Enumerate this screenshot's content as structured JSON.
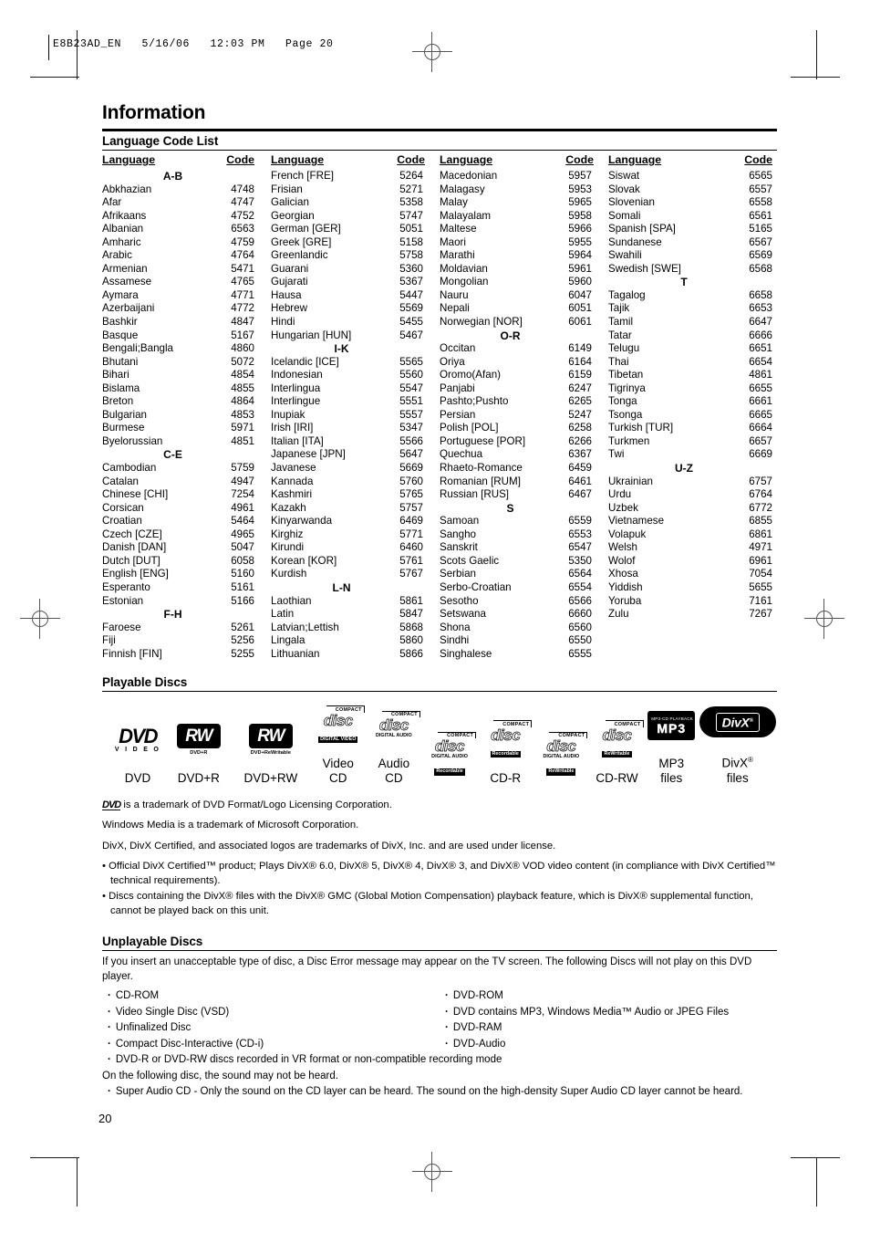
{
  "print_stamp": "E8B23AD_EN   5/16/06   12:03 PM   Page 20",
  "chapter_title": "Information",
  "page_number": "20",
  "language_section": {
    "heading": "Language Code List",
    "columns": [
      {
        "header_language": "Language",
        "header_code": "Code",
        "rows": [
          {
            "group": "A-B"
          },
          {
            "name": "Abkhazian",
            "code": "4748"
          },
          {
            "name": "Afar",
            "code": "4747"
          },
          {
            "name": "Afrikaans",
            "code": "4752"
          },
          {
            "name": "Albanian",
            "code": "6563"
          },
          {
            "name": "Amharic",
            "code": "4759"
          },
          {
            "name": "Arabic",
            "code": "4764"
          },
          {
            "name": "Armenian",
            "code": "5471"
          },
          {
            "name": "Assamese",
            "code": "4765"
          },
          {
            "name": "Aymara",
            "code": "4771"
          },
          {
            "name": "Azerbaijani",
            "code": "4772"
          },
          {
            "name": "Bashkir",
            "code": "4847"
          },
          {
            "name": "Basque",
            "code": "5167"
          },
          {
            "name": "Bengali;Bangla",
            "code": "4860"
          },
          {
            "name": "Bhutani",
            "code": "5072"
          },
          {
            "name": "Bihari",
            "code": "4854"
          },
          {
            "name": "Bislama",
            "code": "4855"
          },
          {
            "name": "Breton",
            "code": "4864"
          },
          {
            "name": "Bulgarian",
            "code": "4853"
          },
          {
            "name": "Burmese",
            "code": "5971"
          },
          {
            "name": "Byelorussian",
            "code": "4851"
          },
          {
            "group": "C-E"
          },
          {
            "name": "Cambodian",
            "code": "5759"
          },
          {
            "name": "Catalan",
            "code": "4947"
          },
          {
            "name": "Chinese [CHI]",
            "code": "7254"
          },
          {
            "name": "Corsican",
            "code": "4961"
          },
          {
            "name": "Croatian",
            "code": "5464"
          },
          {
            "name": "Czech [CZE]",
            "code": "4965"
          },
          {
            "name": "Danish [DAN]",
            "code": "5047"
          },
          {
            "name": "Dutch [DUT]",
            "code": "6058"
          },
          {
            "name": "English [ENG]",
            "code": "5160"
          },
          {
            "name": "Esperanto",
            "code": "5161"
          },
          {
            "name": "Estonian",
            "code": "5166"
          },
          {
            "group": "F-H"
          },
          {
            "name": "Faroese",
            "code": "5261"
          },
          {
            "name": "Fiji",
            "code": "5256"
          },
          {
            "name": "Finnish [FIN]",
            "code": "5255"
          }
        ]
      },
      {
        "header_language": "Language",
        "header_code": "Code",
        "rows": [
          {
            "name": "French [FRE]",
            "code": "5264"
          },
          {
            "name": "Frisian",
            "code": "5271"
          },
          {
            "name": "Galician",
            "code": "5358"
          },
          {
            "name": "Georgian",
            "code": "5747"
          },
          {
            "name": "German [GER]",
            "code": "5051"
          },
          {
            "name": "Greek [GRE]",
            "code": "5158"
          },
          {
            "name": "Greenlandic",
            "code": "5758"
          },
          {
            "name": "Guarani",
            "code": "5360"
          },
          {
            "name": "Gujarati",
            "code": "5367"
          },
          {
            "name": "Hausa",
            "code": "5447"
          },
          {
            "name": "Hebrew",
            "code": "5569"
          },
          {
            "name": "Hindi",
            "code": "5455"
          },
          {
            "name": "Hungarian [HUN]",
            "code": "5467"
          },
          {
            "group": "I-K"
          },
          {
            "name": "Icelandic [ICE]",
            "code": "5565"
          },
          {
            "name": "Indonesian",
            "code": "5560"
          },
          {
            "name": "Interlingua",
            "code": "5547"
          },
          {
            "name": "Interlingue",
            "code": "5551"
          },
          {
            "name": "Inupiak",
            "code": "5557"
          },
          {
            "name": "Irish [IRI]",
            "code": "5347"
          },
          {
            "name": "Italian [ITA]",
            "code": "5566"
          },
          {
            "name": "Japanese [JPN]",
            "code": "5647"
          },
          {
            "name": "Javanese",
            "code": "5669"
          },
          {
            "name": "Kannada",
            "code": "5760"
          },
          {
            "name": "Kashmiri",
            "code": "5765"
          },
          {
            "name": "Kazakh",
            "code": "5757"
          },
          {
            "name": "Kinyarwanda",
            "code": "6469"
          },
          {
            "name": "Kirghiz",
            "code": "5771"
          },
          {
            "name": "Kirundi",
            "code": "6460"
          },
          {
            "name": "Korean [KOR]",
            "code": "5761"
          },
          {
            "name": "Kurdish",
            "code": "5767"
          },
          {
            "group": "L-N"
          },
          {
            "name": "Laothian",
            "code": "5861"
          },
          {
            "name": "Latin",
            "code": "5847"
          },
          {
            "name": "Latvian;Lettish",
            "code": "5868"
          },
          {
            "name": "Lingala",
            "code": "5860"
          },
          {
            "name": "Lithuanian",
            "code": "5866"
          }
        ]
      },
      {
        "header_language": "Language",
        "header_code": "Code",
        "rows": [
          {
            "name": "Macedonian",
            "code": "5957"
          },
          {
            "name": "Malagasy",
            "code": "5953"
          },
          {
            "name": "Malay",
            "code": "5965"
          },
          {
            "name": "Malayalam",
            "code": "5958"
          },
          {
            "name": "Maltese",
            "code": "5966"
          },
          {
            "name": "Maori",
            "code": "5955"
          },
          {
            "name": "Marathi",
            "code": "5964"
          },
          {
            "name": "Moldavian",
            "code": "5961"
          },
          {
            "name": "Mongolian",
            "code": "5960"
          },
          {
            "name": "Nauru",
            "code": "6047"
          },
          {
            "name": "Nepali",
            "code": "6051"
          },
          {
            "name": "Norwegian [NOR]",
            "code": "6061"
          },
          {
            "group": "O-R"
          },
          {
            "name": "Occitan",
            "code": "6149"
          },
          {
            "name": "Oriya",
            "code": "6164"
          },
          {
            "name": "Oromo(Afan)",
            "code": "6159"
          },
          {
            "name": "Panjabi",
            "code": "6247"
          },
          {
            "name": "Pashto;Pushto",
            "code": "6265"
          },
          {
            "name": "Persian",
            "code": "5247"
          },
          {
            "name": "Polish [POL]",
            "code": "6258"
          },
          {
            "name": "Portuguese [POR]",
            "code": "6266"
          },
          {
            "name": "Quechua",
            "code": "6367"
          },
          {
            "name": "Rhaeto-Romance",
            "code": "6459"
          },
          {
            "name": "Romanian [RUM]",
            "code": "6461"
          },
          {
            "name": "Russian [RUS]",
            "code": "6467"
          },
          {
            "group": "S"
          },
          {
            "name": "Samoan",
            "code": "6559"
          },
          {
            "name": "Sangho",
            "code": "6553"
          },
          {
            "name": "Sanskrit",
            "code": "6547"
          },
          {
            "name": "Scots Gaelic",
            "code": "5350"
          },
          {
            "name": "Serbian",
            "code": "6564"
          },
          {
            "name": "Serbo-Croatian",
            "code": "6554"
          },
          {
            "name": "Sesotho",
            "code": "6566"
          },
          {
            "name": "Setswana",
            "code": "6660"
          },
          {
            "name": "Shona",
            "code": "6560"
          },
          {
            "name": "Sindhi",
            "code": "6550"
          },
          {
            "name": "Singhalese",
            "code": "6555"
          }
        ]
      },
      {
        "header_language": "Language",
        "header_code": "Code",
        "rows": [
          {
            "name": "Siswat",
            "code": "6565"
          },
          {
            "name": "Slovak",
            "code": "6557"
          },
          {
            "name": "Slovenian",
            "code": "6558"
          },
          {
            "name": "Somali",
            "code": "6561"
          },
          {
            "name": "Spanish [SPA]",
            "code": "5165"
          },
          {
            "name": "Sundanese",
            "code": "6567"
          },
          {
            "name": "Swahili",
            "code": "6569"
          },
          {
            "name": "Swedish [SWE]",
            "code": "6568"
          },
          {
            "group": "T"
          },
          {
            "name": "Tagalog",
            "code": "6658"
          },
          {
            "name": "Tajik",
            "code": "6653"
          },
          {
            "name": "Tamil",
            "code": "6647"
          },
          {
            "name": "Tatar",
            "code": "6666"
          },
          {
            "name": "Telugu",
            "code": "6651"
          },
          {
            "name": "Thai",
            "code": "6654"
          },
          {
            "name": "Tibetan",
            "code": "4861"
          },
          {
            "name": "Tigrinya",
            "code": "6655"
          },
          {
            "name": "Tonga",
            "code": "6661"
          },
          {
            "name": "Tsonga",
            "code": "6665"
          },
          {
            "name": "Turkish [TUR]",
            "code": "6664"
          },
          {
            "name": "Turkmen",
            "code": "6657"
          },
          {
            "name": "Twi",
            "code": "6669"
          },
          {
            "group": "U-Z"
          },
          {
            "name": "Ukrainian",
            "code": "6757"
          },
          {
            "name": "Urdu",
            "code": "6764"
          },
          {
            "name": "Uzbek",
            "code": "6772"
          },
          {
            "name": "Vietnamese",
            "code": "6855"
          },
          {
            "name": "Volapuk",
            "code": "6861"
          },
          {
            "name": "Welsh",
            "code": "4971"
          },
          {
            "name": "Wolof",
            "code": "6961"
          },
          {
            "name": "Xhosa",
            "code": "7054"
          },
          {
            "name": "Yiddish",
            "code": "5655"
          },
          {
            "name": "Yoruba",
            "code": "7161"
          },
          {
            "name": "Zulu",
            "code": "7267"
          }
        ]
      }
    ]
  },
  "playable": {
    "heading": "Playable Discs",
    "discs": [
      {
        "icon": "dvd-video-logo",
        "logo_main": "DVD",
        "logo_sub": "V I D E O",
        "caption": "DVD"
      },
      {
        "icon": "dvd-plus-r-logo",
        "logo_main": "RW",
        "logo_sub": "DVD+R",
        "caption": "DVD+R"
      },
      {
        "icon": "dvd-plus-rw-logo",
        "logo_main": "RW",
        "logo_sub": "DVD+ReWritable",
        "caption": "DVD+RW"
      },
      {
        "icon": "compact-disc-digital-video-logo",
        "logo_top": "COMPACT",
        "logo_main": "disc",
        "logo_sub": "DIGITAL VIDEO",
        "caption": "Video\nCD"
      },
      {
        "icon": "compact-disc-digital-audio-logo",
        "logo_top": "COMPACT",
        "logo_main": "disc",
        "logo_sub": "DIGITAL AUDIO",
        "caption": "Audio\nCD"
      },
      {
        "icon": "compact-disc-digital-audio-recordable-logo",
        "logo_top": "COMPACT",
        "logo_main": "disc",
        "logo_sub": "DIGITAL AUDIO",
        "logo_sub2": "Recordable",
        "caption": ""
      },
      {
        "icon": "compact-disc-recordable-logo",
        "logo_top": "COMPACT",
        "logo_main": "disc",
        "logo_sub2": "Recordable",
        "caption": "CD-R"
      },
      {
        "icon": "compact-disc-digital-audio-rewritable-logo",
        "logo_top": "COMPACT",
        "logo_main": "disc",
        "logo_sub": "DIGITAL AUDIO",
        "logo_sub2": "ReWritable",
        "caption": ""
      },
      {
        "icon": "compact-disc-rewritable-logo",
        "logo_top": "COMPACT",
        "logo_main": "disc",
        "logo_sub2": "ReWritable",
        "caption": "CD-RW"
      },
      {
        "icon": "mp3-logo",
        "logo_top": "MP3-CD PLAYBACK",
        "logo_main": "MP3",
        "caption": "MP3\nfiles"
      },
      {
        "icon": "divx-logo",
        "logo_main": "DivX",
        "caption_main": "DivX",
        "caption_sup": "®",
        "caption_second": "files"
      }
    ]
  },
  "trademark_notes": {
    "dvd_logo_note_suffix": " is a trademark of DVD Format/Logo Licensing Corporation.",
    "dvd_logo_glyph": "DVD",
    "windows_media": "Windows Media is a trademark of Microsoft Corporation.",
    "divx_trademark": "DivX, DivX Certified, and associated logos are trademarks of DivX, Inc. and are used under license.",
    "bullet_1": "• Official DivX Certified™ product; Plays DivX® 6.0, DivX® 5, DivX® 4, DivX® 3, and DivX® VOD video content (in compliance with DivX Certified™ technical requirements).",
    "bullet_2": "• Discs containing the DivX® files with the DivX® GMC (Global Motion Compensation) playback feature, which is DivX® supplemental function, cannot be played back on this unit."
  },
  "unplayable": {
    "heading": "Unplayable Discs",
    "intro": "If you insert an unacceptable type of disc, a Disc Error message may appear on the TV screen. The following Discs will not play on this DVD player.",
    "left_items": [
      "CD-ROM",
      "Video Single Disc (VSD)",
      "Unfinalized Disc",
      "Compact Disc-Interactive (CD-i)"
    ],
    "right_items": [
      "DVD-ROM",
      "DVD contains MP3, Windows Media™ Audio or JPEG Files",
      "DVD-RAM",
      "DVD-Audio"
    ],
    "wide_item": "DVD-R or DVD-RW discs recorded in VR format or non-compatible recording mode",
    "sound_note": "On the following disc, the sound may not be heard.",
    "sound_item": "Super Audio CD - Only the sound on the CD layer can be heard. The sound on the high-density Super Audio CD layer cannot be heard."
  }
}
